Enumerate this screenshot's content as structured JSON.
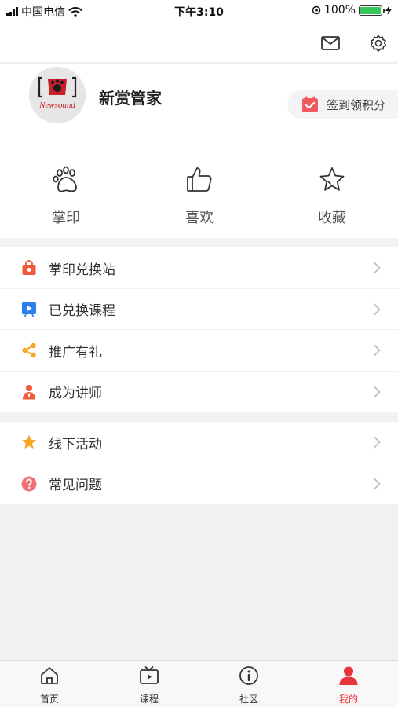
{
  "status_bar": {
    "carrier": "中国电信",
    "time": "下午3:10",
    "battery": "100%",
    "battery_level": 1.0
  },
  "header": {
    "mail_icon": "mail-icon",
    "settings_icon": "gear-icon"
  },
  "profile": {
    "username": "新赏管家",
    "avatar_logo_text": "Newsound",
    "signin_label": "签到领积分"
  },
  "quick_actions": [
    {
      "label": "掌印",
      "icon": "paw-icon"
    },
    {
      "label": "喜欢",
      "icon": "thumbs-up-icon"
    },
    {
      "label": "收藏",
      "icon": "star-outline-icon"
    }
  ],
  "menu_group_1": [
    {
      "label": "掌印兑换站",
      "icon": "shopping-bag-icon",
      "color": "#f05a3c"
    },
    {
      "label": "已兑换课程",
      "icon": "video-board-icon",
      "color": "#2d7ff0"
    },
    {
      "label": "推广有礼",
      "icon": "share-icon",
      "color": "#f5a623"
    },
    {
      "label": "成为讲师",
      "icon": "lecturer-icon",
      "color": "#f05a3c"
    }
  ],
  "menu_group_2": [
    {
      "label": "线下活动",
      "icon": "star-filled-icon",
      "color": "#f5a623"
    },
    {
      "label": "常见问题",
      "icon": "question-icon",
      "color": "#f07272"
    }
  ],
  "tabs": [
    {
      "label": "首页",
      "icon": "home-icon"
    },
    {
      "label": "课程",
      "icon": "tv-icon"
    },
    {
      "label": "社区",
      "icon": "info-icon"
    },
    {
      "label": "我的",
      "icon": "user-icon",
      "active": true
    }
  ],
  "colors": {
    "accent": "#e8343d",
    "signin": "#f25a5f"
  }
}
